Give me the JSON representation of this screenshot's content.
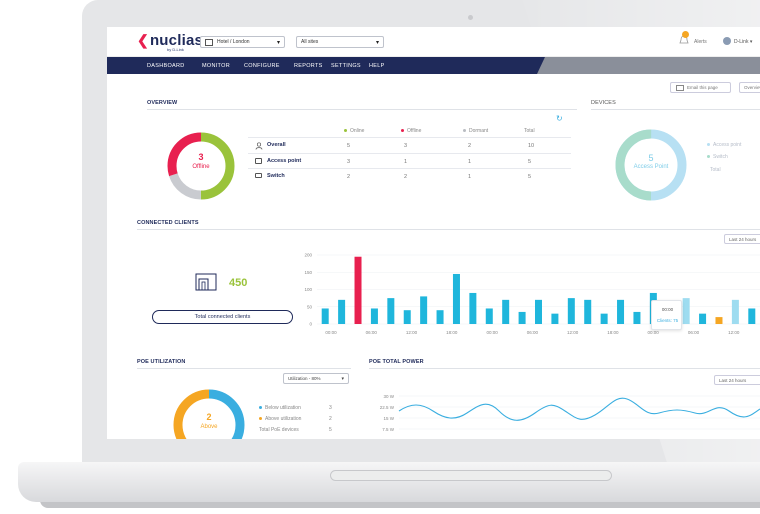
{
  "app": {
    "logo_text": "nuclias",
    "logo_sub": "by D-Link",
    "site_select": "Hotel / London",
    "sites_select": "All sites",
    "alerts_label": "Alerts",
    "user_label": "D-Link"
  },
  "nav": [
    "DASHBOARD",
    "MONITOR",
    "CONFIGURE",
    "REPORTS",
    "SETTINGS",
    "HELP"
  ],
  "actions": {
    "email": "Email this page",
    "overview": "Overview"
  },
  "overview": {
    "title": "OVERVIEW",
    "donut_value": "3",
    "donut_label": "Offline",
    "columns": [
      "Online",
      "Offline",
      "Dormant",
      "Total"
    ],
    "rows": [
      {
        "label": "Overall",
        "online": "5",
        "offline": "3",
        "dormant": "2",
        "total": "10"
      },
      {
        "label": "Access point",
        "online": "3",
        "offline": "1",
        "dormant": "1",
        "total": "5"
      },
      {
        "label": "Switch",
        "online": "2",
        "offline": "2",
        "dormant": "1",
        "total": "5"
      }
    ],
    "donut_segments": {
      "online": 5,
      "offline": 3,
      "dormant": 2
    }
  },
  "devices": {
    "title": "DEVICES",
    "donut_value": "5",
    "donut_label": "Access Point",
    "legend": [
      "Access point",
      "Switch",
      "Total"
    ]
  },
  "connected_clients": {
    "title": "CONNECTED CLIENTS",
    "total": "450",
    "button": "Total connected clients",
    "range": "Last 24 hours",
    "tooltip_time": "00:00",
    "tooltip_value": "Clients: 75"
  },
  "chart_data": {
    "type": "bar",
    "y_ticks": [
      "200",
      "150",
      "100",
      "50",
      "0"
    ],
    "ylim": [
      0,
      200
    ],
    "x_tick_labels": [
      "00:00",
      "06:00",
      "12:00",
      "18:00",
      "00:00",
      "06:00",
      "12:00",
      "18:00",
      "00:00",
      "06:00",
      "12:00"
    ],
    "values": [
      45,
      70,
      195,
      45,
      75,
      40,
      80,
      40,
      145,
      90,
      45,
      70,
      35,
      70,
      30,
      75,
      70,
      30,
      70,
      35,
      90,
      35,
      75,
      30,
      20,
      70,
      45
    ],
    "highlight": {
      "index": 2,
      "color": "#e8204f"
    },
    "orange_index": 24,
    "light_indices": [
      22,
      25
    ],
    "bar_color": "#1fb6dc",
    "orange_color": "#f5a623",
    "light_color": "#9edcf0"
  },
  "poe_utilization": {
    "title": "POE UTILIZATION",
    "select": "Utilization - 80%",
    "donut_value": "2",
    "donut_label": "Above",
    "legend": [
      {
        "label": "Below utilization",
        "value": "3",
        "color": "#3aaee0"
      },
      {
        "label": "Above utilization",
        "value": "2",
        "color": "#f5a623"
      },
      {
        "label": "Total PoE devices",
        "value": "5",
        "color": ""
      }
    ]
  },
  "poe_total_power": {
    "title": "POE TOTAL POWER",
    "range": "Last 24 hours",
    "y_ticks": [
      "30 W",
      "22.5 W",
      "15 W",
      "7.5 W"
    ]
  }
}
